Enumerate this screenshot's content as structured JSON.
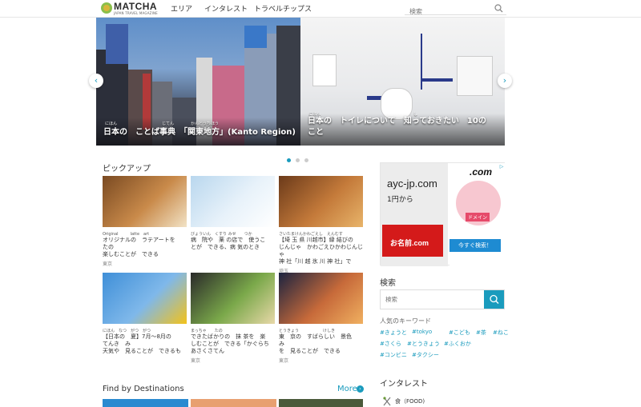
{
  "header": {
    "logo_text": "MATCHA",
    "logo_sub": "JAPAN TRAVEL MAGAZINE",
    "nav": [
      "エリア",
      "インタレスト",
      "トラベルチップス"
    ],
    "search_placeholder": "検索"
  },
  "hero": {
    "slide1": {
      "ruby_1": "にほん",
      "ruby_2": "じてん",
      "ruby_3": "かんとうちほう",
      "caption": "日本の　ことば事典　「関東地方」(Kanto Region)"
    },
    "slide2": {
      "ruby_1": "にほん",
      "ruby_2": "し",
      "caption_line1": "日本の　トイレについて　知っておきたい　10の",
      "caption_line2": "こと"
    },
    "prev_label": "‹",
    "next_label": "›",
    "dots_count": 3,
    "active_dot": 1
  },
  "pickup": {
    "title": "ピックアップ",
    "cards": [
      {
        "ruby": "Original　　　latte　art",
        "text": "オリジナルの　ラテアートを\nたの\n楽しむことが　できる",
        "loc": "東京",
        "colors": [
          "#7a4a22",
          "#c98a4a",
          "#f2e3c6"
        ]
      },
      {
        "ruby": "びょういん　くすり みせ　　つか",
        "text": "病　院や　薬 の店で　使うこ\nとが　できる、病 気のとき",
        "loc": "",
        "colors": [
          "#b9d7ee",
          "#e8f2fa",
          "#ffffff"
        ]
      },
      {
        "ruby": "さいたまけんかわごえし　えんむす",
        "text": "【埼 玉 県 川越市】縁 結びの\nじんじゃ　かわごえひかわじんじゃ\n神 社「川 越 氷 川 神 社」で",
        "loc": "埼玉",
        "colors": [
          "#6b3a1a",
          "#c47a3a",
          "#e8b46a"
        ]
      },
      {
        "ruby": "にほん　なつ　がつ　がつ",
        "text": "【日本の　夏】7月〜8月の\nてんき　み\n天気や　見ることが　できるも",
        "loc": "",
        "colors": [
          "#3f8fd8",
          "#7fb8ea",
          "#f3c21a"
        ]
      },
      {
        "ruby": "まっちゃ　　たの",
        "text": "できたばかりの　抹 茶を　楽\nしむことが　できる「かぐらち\nあさくさてん",
        "loc": "東京",
        "colors": [
          "#2a2a2a",
          "#7aa84a",
          "#e8d8a8"
        ]
      },
      {
        "ruby": "とうきょう　　　　　　けしき",
        "text": "東　京の　すばらしい　景色\nみ\nを　見ることが　できる",
        "loc": "東京",
        "colors": [
          "#1b2340",
          "#c76a3a",
          "#f0b060"
        ]
      }
    ]
  },
  "ad": {
    "domain": "ayc-jp.com",
    "price": "1円から",
    "red_text": "お名前.com",
    "com": ".com",
    "tag": "ドメイン",
    "cta": "今すぐ検索！",
    "badge": "▷"
  },
  "sidebar": {
    "search_title": "検索",
    "search_placeholder": "検索",
    "keywords_title": "人気のキーワード",
    "keywords_row1": [
      "#きょうと",
      "#tokyo",
      "#こども",
      "#茶",
      "#ねこ"
    ],
    "keywords_row2": [
      "#さくら",
      "#とうきょう",
      "#ふくおか"
    ],
    "keywords_row3": [
      "#コンビニ",
      "#タクシー"
    ],
    "interest_title": "インタレスト",
    "food_label": "食（FOOD)"
  },
  "destinations": {
    "title": "Find by Destinations",
    "more": "More"
  }
}
